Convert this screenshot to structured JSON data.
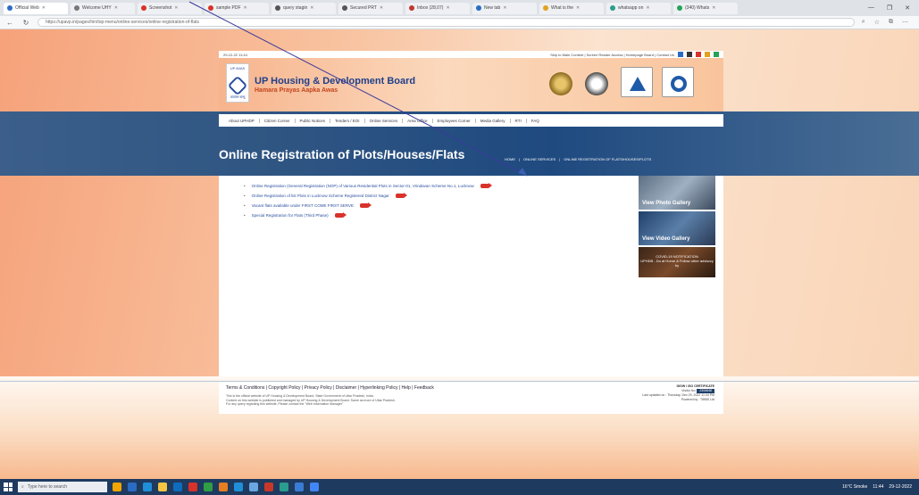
{
  "browser": {
    "tabs": [
      {
        "label": "Official Web",
        "color": "#2a6cc4",
        "active": true
      },
      {
        "label": "Welcome UHY",
        "color": "#777"
      },
      {
        "label": "Screenshot",
        "color": "#d8322a"
      },
      {
        "label": "sample PDF",
        "color": "#d8322a"
      },
      {
        "label": "query stagin",
        "color": "#555"
      },
      {
        "label": "Secured PRT",
        "color": "#555"
      },
      {
        "label": "Inbox (28,07)",
        "color": "#c0392b"
      },
      {
        "label": "New tab",
        "color": "#2a6cc4"
      },
      {
        "label": "What is the",
        "color": "#e1a21f"
      },
      {
        "label": "whatsapp on",
        "color": "#2a9d8f"
      },
      {
        "label": "(340) Whats",
        "color": "#25a35a"
      }
    ],
    "url": "https://upavp.in/pages/hin/top-menu/online-services/online-registration-of-flats",
    "window_controls": [
      "—",
      "❐",
      "✕"
    ]
  },
  "util_strip": {
    "datetime": "29-12-22 11:44",
    "links": "Skip to Main Content | Screen Reader Access | Homepage Board | Contact Us"
  },
  "header": {
    "logo_top": "UP AVAS",
    "logo_bottom": "आवास बन्धु",
    "title": "UP Housing & Development Board",
    "subtitle": "Hamara Prayas Aapka Awas"
  },
  "menu": [
    "About UPHDP",
    "Citizen Corner",
    "Public Notices",
    "Tenders / EOI",
    "Online Services",
    "Area Office",
    "Employees Corner",
    "Media Gallery",
    "RTI",
    "FAQ"
  ],
  "page": {
    "title": "Online Registration of Plots/Houses/Flats",
    "breadcrumb": [
      "HOME",
      "ONLINE SERVICES",
      "ONLINE REGISTRATION OF FLATS/HOUSES/PLOTS"
    ]
  },
  "links": [
    "Online Registration (General Registration (NOP) of Various Residential Plots in Sector-01, Vrindavan Scheme No.1, Lucknow",
    "Online Registration of list Plots in Lucknow Scheme Registered District Nagar",
    "Vacant flats available under FIRST COME FIRST SERVE",
    "Special Registration for Flats (Third Phase)"
  ],
  "sidebar": {
    "photo_label": "View Photo Gallery",
    "video_label": "View Video Gallery",
    "notice_title": "COVID-19 NOTIFICATION",
    "notice_sub": "UPHDB - Do at Home & Follow other advisory by"
  },
  "footer": {
    "links": "Terms & Conditions | Copyright Policy | Privacy Policy | Disclaimer | Hyperlinking Policy | Help | Feedback",
    "note1": "This is the official website of UP Housing & Development Board, State Government of Uttar Pradesh, India.",
    "note2": "Content on this website is published and managed by UP Housing & Development Board. Same as more of Uttar Pradesh.",
    "note3": "For any query regarding this website, Please contact the \"Web Information Manager\"",
    "cert": "GIGW / ISO CERTIFICATE",
    "visitor_label": "Visitor No:",
    "visitor_count": "2306848",
    "updated": "Last updated on : Thursday, Dec 29, 2022 11:44 PM",
    "powered": "Powered by : TIBBS Ltd"
  },
  "taskbar": {
    "search_placeholder": "Type here to search",
    "weather": "16°C  Smoke",
    "time": "11:44",
    "date": "29-12-2022"
  }
}
